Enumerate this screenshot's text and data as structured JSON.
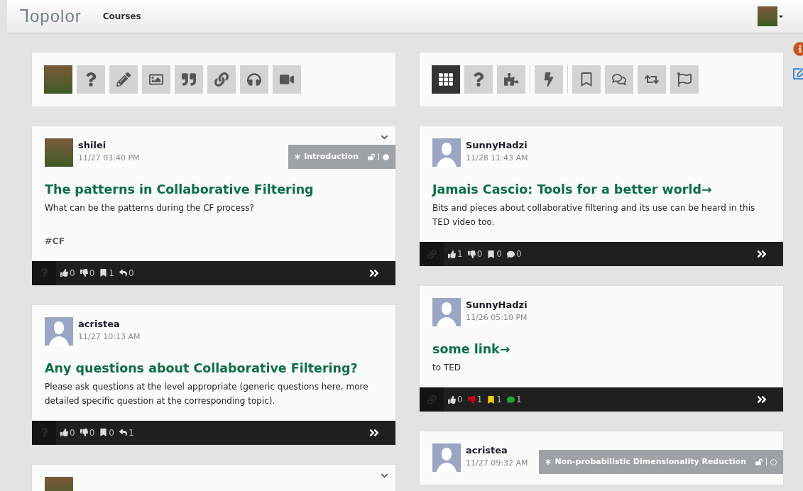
{
  "header": {
    "logo": "ꓶopolor",
    "nav": [
      {
        "label": "Courses",
        "selected": true
      }
    ],
    "user_avatar": {
      "kind": "photo"
    }
  },
  "columns": [
    {
      "toolbar": {
        "groups": [
          [
            {
              "kind": "avatar",
              "selected": false
            },
            {
              "kind": "question",
              "selected": false
            },
            {
              "kind": "pencil",
              "selected": false
            },
            {
              "kind": "image",
              "selected": false
            },
            {
              "kind": "quote",
              "selected": false
            },
            {
              "kind": "link",
              "selected": false
            },
            {
              "kind": "audio",
              "selected": false
            },
            {
              "kind": "video",
              "selected": false
            }
          ]
        ]
      },
      "posts": [
        {
          "kind": "question",
          "avatar": {
            "kind": "photo"
          },
          "author": "shilei",
          "time": "11/27 03:40 PM",
          "collapsible": true,
          "topic": {
            "label": "Introduction",
            "done": true
          },
          "title": "The patterns in Collaborative Filtering",
          "body": "What can be the patterns during the CF process?",
          "tag": "#CF",
          "stats": [
            {
              "kind": "like",
              "count": "0",
              "active": false
            },
            {
              "kind": "dislike",
              "count": "0",
              "active": false
            },
            {
              "kind": "bookmark",
              "count": "1",
              "active": false
            },
            {
              "kind": "reply",
              "count": "0",
              "active": false
            }
          ]
        },
        {
          "kind": "question",
          "avatar": {
            "kind": "default"
          },
          "author": "acristea",
          "time": "11/27 10:13 AM",
          "collapsible": false,
          "title": "Any questions about Collaborative Filtering?",
          "body": "Please ask questions at the level appropriate (generic questions here, more detailed specific question at the corresponding topic).",
          "stats": [
            {
              "kind": "like",
              "count": "0",
              "active": false
            },
            {
              "kind": "dislike",
              "count": "0",
              "active": false
            },
            {
              "kind": "bookmark",
              "count": "0",
              "active": false
            },
            {
              "kind": "reply",
              "count": "1",
              "active": false
            }
          ]
        },
        {
          "kind": "question",
          "avatar": {
            "kind": "photo"
          },
          "collapsible": true
        }
      ]
    },
    {
      "toolbar": {
        "groups": [
          [
            {
              "kind": "grid",
              "selected": true
            },
            {
              "kind": "question",
              "selected": false
            },
            {
              "kind": "puzzle",
              "selected": false
            }
          ],
          [
            {
              "kind": "bolt",
              "selected": false
            }
          ],
          [
            {
              "kind": "bookmark",
              "selected": false
            },
            {
              "kind": "comments",
              "selected": false
            },
            {
              "kind": "retweet",
              "selected": false
            },
            {
              "kind": "flag",
              "selected": false
            }
          ]
        ]
      },
      "posts": [
        {
          "kind": "link",
          "avatar": {
            "kind": "default"
          },
          "author": "SunnyHadzi",
          "time": "11/28 11:43 AM",
          "collapsible": false,
          "title": "Jamais Cascio: Tools for a better world→",
          "body": "Bits and pieces about collaborative filtering and its use can be heard in this TED video too.",
          "stats": [
            {
              "kind": "like",
              "count": "1",
              "active": false
            },
            {
              "kind": "dislike",
              "count": "0",
              "active": false
            },
            {
              "kind": "bookmark",
              "count": "0",
              "active": false
            },
            {
              "kind": "comment",
              "count": "0",
              "active": false
            }
          ]
        },
        {
          "kind": "link",
          "avatar": {
            "kind": "default"
          },
          "author": "SunnyHadzi",
          "time": "11/26 05:10 PM",
          "collapsible": false,
          "title": "some link→",
          "body": "to TED",
          "stats": [
            {
              "kind": "like",
              "count": "0",
              "active": false
            },
            {
              "kind": "dislike",
              "count": "1",
              "active": true
            },
            {
              "kind": "bookmark",
              "count": "1",
              "active": true
            },
            {
              "kind": "comment",
              "count": "1",
              "active": true
            }
          ]
        },
        {
          "kind": "link",
          "avatar": {
            "kind": "default"
          },
          "author": "acristea",
          "time": "11/27 09:32 AM",
          "collapsible": false,
          "topic": {
            "label": "Non-probabilistic Dimensionality Reduction",
            "done": false
          }
        }
      ]
    }
  ],
  "side_actions": [
    {
      "kind": "info"
    },
    {
      "kind": "edit"
    }
  ]
}
